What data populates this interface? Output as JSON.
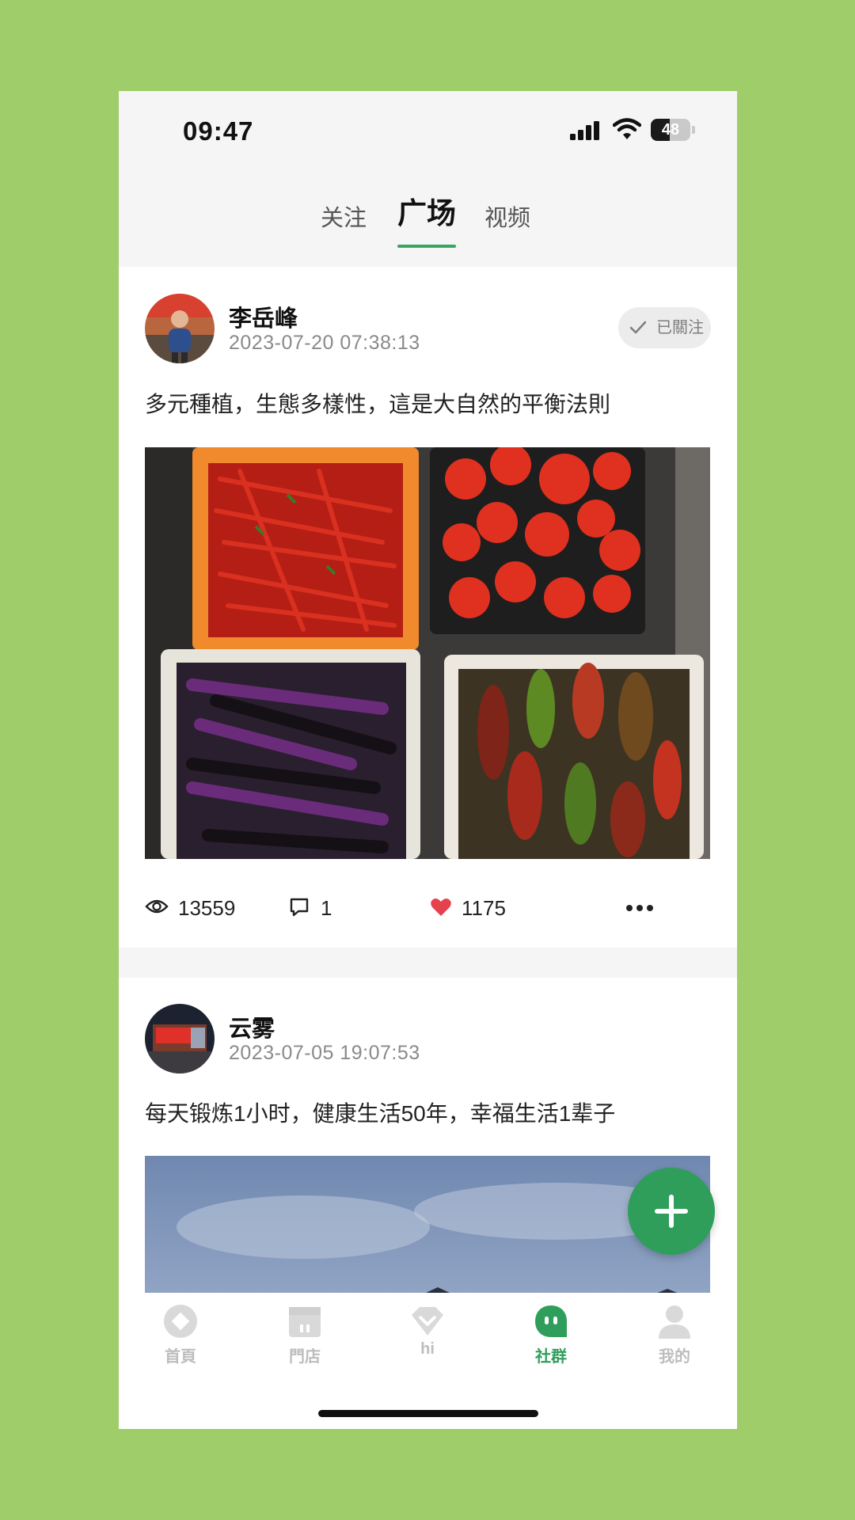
{
  "status_bar": {
    "time": "09:47",
    "battery": "48",
    "battery_fraction": 0.48
  },
  "tabs": [
    {
      "label": "关注",
      "active": false
    },
    {
      "label": "广场",
      "active": true
    },
    {
      "label": "视频",
      "active": false
    }
  ],
  "posts": [
    {
      "author": "李岳峰",
      "time": "2023-07-20 07:38:13",
      "follow_label": "已關注",
      "text": "多元種植，生態多樣性，這是大自然的平衡法則",
      "views": "13559",
      "comments": "1",
      "likes": "1175"
    },
    {
      "author": "云雾",
      "time": "2023-07-05 19:07:53",
      "text": "每天锻炼1小时，健康生活50年，幸福生活1辈子"
    }
  ],
  "bottom_nav": [
    {
      "label": "首頁",
      "icon": "home-icon",
      "active": false
    },
    {
      "label": "門店",
      "icon": "store-icon",
      "active": false
    },
    {
      "label": "hi",
      "icon": "hi-icon",
      "active": false
    },
    {
      "label": "社群",
      "icon": "community-icon",
      "active": true
    },
    {
      "label": "我的",
      "icon": "profile-icon",
      "active": false
    }
  ],
  "colors": {
    "accent": "#2f9e5b",
    "background": "#9fcd6a",
    "like": "#e5424d"
  }
}
